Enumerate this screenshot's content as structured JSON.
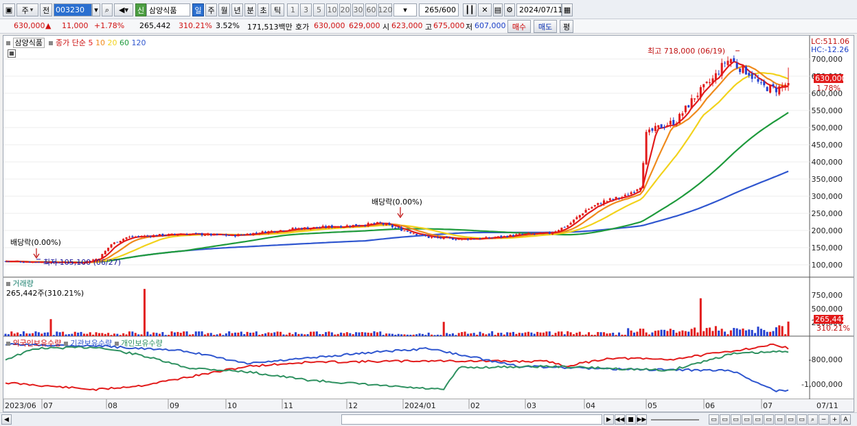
{
  "toolbar": {
    "type": "주",
    "prev": "전",
    "code": "003230",
    "badge": "신",
    "name": "삼양식품",
    "periods": [
      "일",
      "주",
      "월",
      "년",
      "분",
      "초",
      "틱"
    ],
    "period_selected": "일",
    "intervals": [
      "1",
      "3",
      "5",
      "10",
      "20",
      "30",
      "60",
      "120"
    ],
    "count_display": "265/600",
    "date": "2024/07/11"
  },
  "info": {
    "price": "630,000",
    "change_arrow": "▲",
    "change": "11,000",
    "change_pct": "+1.78%",
    "volume": "265,442",
    "vol_ratio": "310.21%",
    "turnover": "3.52%",
    "amount": "171,513백만",
    "bid_label": "호가",
    "bid1": "630,000",
    "bid2": "629,000",
    "open_label": "시",
    "open": "623,000",
    "high_label": "고",
    "high": "675,000",
    "low_label": "저",
    "low": "607,000",
    "buy_label": "매수",
    "sell_label": "매도",
    "eval_label": "평"
  },
  "price_legend": {
    "name": "삼양식품",
    "ma_label": "종가 단순",
    "periods": [
      "5",
      "10",
      "20",
      "60",
      "120"
    ],
    "colors": [
      "#e21b1b",
      "#ef8a1c",
      "#f2d21b",
      "#1e9a3c",
      "#2f56cf"
    ]
  },
  "volume_legend": {
    "title": "거래량",
    "value": "265,442주(310.21%)"
  },
  "holding_legend": {
    "items": [
      "외국인보유수량",
      "기관보유수량",
      "개인보유수량"
    ],
    "colors": [
      "#e21b1b",
      "#2f56cf",
      "#2e9160"
    ]
  },
  "annotations": {
    "max_label": "최고 718,000 (06/19)",
    "min_label": "최저 105,100 (06/27)",
    "dividend1": "배당락(0.00%)",
    "dividend2": "배당락(0.00%)"
  },
  "right_labels": {
    "lc": "LC:511.06",
    "hc": "HC:-12.26",
    "price_tag": "630,000",
    "pct_tag": "1.78%",
    "vol_tag": "265,442",
    "vol_pct_tag": "310.21%"
  },
  "chart_data": [
    {
      "type": "candlestick",
      "title": "삼양식품 일봉",
      "x_labels": [
        "2023/06",
        "07",
        "08",
        "09",
        "10",
        "11",
        "12",
        "2024/01",
        "02",
        "03",
        "04",
        "05",
        "06",
        "07",
        "07/11"
      ],
      "ylim": [
        80000,
        760000
      ],
      "y_ticks": [
        100000,
        150000,
        200000,
        250000,
        300000,
        350000,
        400000,
        450000,
        500000,
        550000,
        600000,
        650000,
        700000
      ],
      "close_anchors": [
        [
          0,
          110000
        ],
        [
          10,
          108000
        ],
        [
          25,
          106000
        ],
        [
          31,
          120000
        ],
        [
          35,
          160000
        ],
        [
          40,
          180000
        ],
        [
          50,
          186000
        ],
        [
          60,
          190000
        ],
        [
          75,
          185000
        ],
        [
          85,
          195000
        ],
        [
          95,
          205000
        ],
        [
          110,
          212000
        ],
        [
          120,
          218000
        ],
        [
          124,
          221000
        ],
        [
          130,
          205000
        ],
        [
          140,
          180000
        ],
        [
          150,
          175000
        ],
        [
          160,
          178000
        ],
        [
          170,
          188000
        ],
        [
          180,
          192000
        ],
        [
          186,
          215000
        ],
        [
          192,
          260000
        ],
        [
          198,
          285000
        ],
        [
          205,
          300000
        ],
        [
          210,
          330000
        ],
        [
          212,
          480000
        ],
        [
          216,
          500000
        ],
        [
          222,
          520000
        ],
        [
          228,
          590000
        ],
        [
          234,
          640000
        ],
        [
          238,
          690000
        ],
        [
          240,
          700000
        ],
        [
          242,
          680000
        ],
        [
          246,
          660000
        ],
        [
          250,
          620000
        ],
        [
          255,
          612000
        ],
        [
          259,
          630000
        ]
      ],
      "series": [
        {
          "name": "5",
          "values_note": "SMA 5"
        },
        {
          "name": "10",
          "values_note": "SMA 10"
        },
        {
          "name": "20",
          "values_note": "SMA 20"
        },
        {
          "name": "60",
          "values_note": "SMA 60"
        },
        {
          "name": "120",
          "values_note": "SMA 120"
        }
      ],
      "last": {
        "open": 623000,
        "high": 675000,
        "low": 607000,
        "close": 630000
      },
      "max": {
        "value": 718000,
        "date": "06/19"
      },
      "min": {
        "value": 105100,
        "date": "06/27"
      }
    },
    {
      "type": "bar",
      "title": "거래량",
      "ylim": [
        0,
        900000
      ],
      "y_ticks": [
        250000,
        500000,
        750000
      ],
      "spikes": [
        [
          46,
          860000
        ],
        [
          15,
          310000
        ],
        [
          230,
          690000
        ],
        [
          145,
          260000
        ],
        [
          259,
          265442
        ]
      ]
    },
    {
      "type": "line",
      "title": "보유수량",
      "y_ticks": [
        -800000,
        -1000000
      ],
      "series": [
        {
          "name": "외국인보유수량"
        },
        {
          "name": "기관보유수량"
        },
        {
          "name": "개인보유수량"
        }
      ]
    }
  ]
}
